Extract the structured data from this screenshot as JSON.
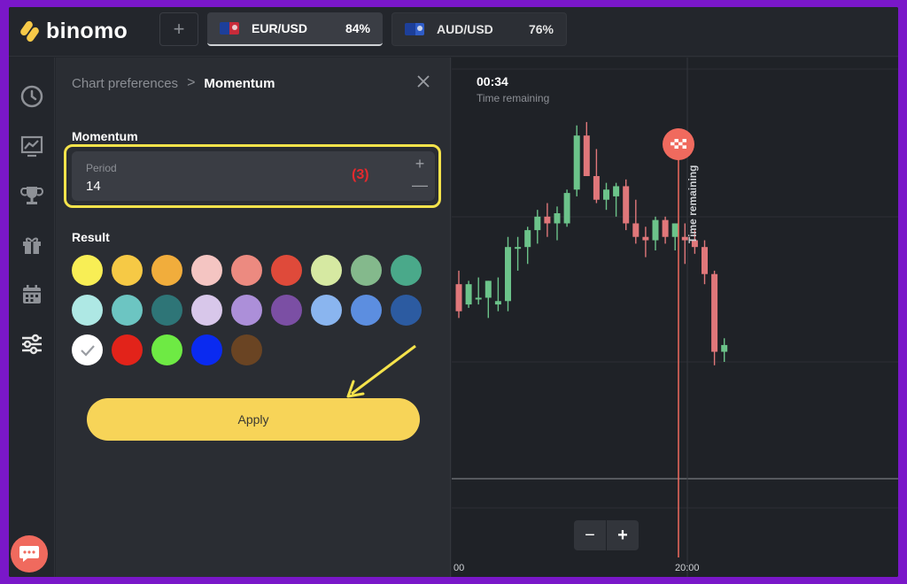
{
  "app": {
    "name": "binomo"
  },
  "header": {
    "add_tab_label": "+",
    "tabs": [
      {
        "asset": "EUR/USD",
        "payout": "84%",
        "active": true
      },
      {
        "asset": "AUD/USD",
        "payout": "76%",
        "active": false
      }
    ]
  },
  "sidebar": {
    "items": [
      {
        "icon": "clock-icon"
      },
      {
        "icon": "chart-icon"
      },
      {
        "icon": "trophy-icon"
      },
      {
        "icon": "gift-icon"
      },
      {
        "icon": "calendar-icon"
      },
      {
        "icon": "sliders-icon",
        "active": true
      }
    ],
    "chat_icon": "chat-icon"
  },
  "panel": {
    "breadcrumb_parent": "Chart preferences",
    "breadcrumb_separator": ">",
    "breadcrumb_current": "Momentum",
    "section_title": "Momentum",
    "period": {
      "label": "Period",
      "value": "14",
      "annotation": "(3)"
    },
    "result_title": "Result",
    "colors": [
      [
        "#f8ee55",
        "#f6c945",
        "#f1ad3c",
        "#f4c5c2",
        "#ec8a80",
        "#df4a3a",
        "#d6e9a2",
        "#84b98c",
        "#4aa98a"
      ],
      [
        "#aee8e4",
        "#6cc5c2",
        "#2e7577",
        "#d8c7ea",
        "#ac8fd9",
        "#7b4fa4",
        "#8ab5ef",
        "#5c8ee0",
        "#2c5ba1"
      ],
      [
        "#ffffff",
        "#e2231a",
        "#6eea44",
        "#0a2af0",
        "#6a4423"
      ]
    ],
    "selected_color": "#ffffff",
    "apply_label": "Apply"
  },
  "chart": {
    "timer": "00:34",
    "timer_label": "Time remaining",
    "expiry_label": "Time remaining",
    "zoom_out_label": "−",
    "zoom_in_label": "+",
    "x_ticks": [
      "00",
      "20:00"
    ],
    "colors": {
      "up": "#6cc38a",
      "down": "#e0777a",
      "expiry": "#f06a5e"
    }
  },
  "chart_data": {
    "type": "candlestick",
    "candles": [
      {
        "o": 56,
        "h": 60,
        "l": 46,
        "c": 48
      },
      {
        "o": 50,
        "h": 57,
        "l": 49,
        "c": 56
      },
      {
        "o": 52,
        "h": 58,
        "l": 50,
        "c": 52
      },
      {
        "o": 52,
        "h": 57,
        "l": 46,
        "c": 57
      },
      {
        "o": 50,
        "h": 58,
        "l": 48,
        "c": 51
      },
      {
        "o": 51,
        "h": 70,
        "l": 48,
        "c": 67
      },
      {
        "o": 67,
        "h": 70,
        "l": 60,
        "c": 67
      },
      {
        "o": 67,
        "h": 73,
        "l": 62,
        "c": 72
      },
      {
        "o": 72,
        "h": 78,
        "l": 68,
        "c": 76
      },
      {
        "o": 76,
        "h": 80,
        "l": 70,
        "c": 74
      },
      {
        "o": 74,
        "h": 79,
        "l": 69,
        "c": 77
      },
      {
        "o": 74,
        "h": 84,
        "l": 73,
        "c": 83
      },
      {
        "o": 84,
        "h": 103,
        "l": 82,
        "c": 100
      },
      {
        "o": 100,
        "h": 104,
        "l": 92,
        "c": 88
      },
      {
        "o": 88,
        "h": 96,
        "l": 80,
        "c": 81
      },
      {
        "o": 81,
        "h": 86,
        "l": 78,
        "c": 84
      },
      {
        "o": 82,
        "h": 86,
        "l": 76,
        "c": 85
      },
      {
        "o": 85,
        "h": 87,
        "l": 72,
        "c": 74
      },
      {
        "o": 74,
        "h": 81,
        "l": 68,
        "c": 70
      },
      {
        "o": 70,
        "h": 73,
        "l": 64,
        "c": 69
      },
      {
        "o": 69,
        "h": 76,
        "l": 66,
        "c": 75
      },
      {
        "o": 75,
        "h": 76,
        "l": 68,
        "c": 70
      },
      {
        "o": 70,
        "h": 74,
        "l": 66,
        "c": 74
      },
      {
        "o": 70,
        "h": 74,
        "l": 62,
        "c": 69
      },
      {
        "o": 69,
        "h": 72,
        "l": 65,
        "c": 67
      },
      {
        "o": 67,
        "h": 69,
        "l": 56,
        "c": 59
      },
      {
        "o": 59,
        "h": 60,
        "l": 32,
        "c": 36
      },
      {
        "o": 36,
        "h": 40,
        "l": 33,
        "c": 38
      }
    ],
    "ylim": [
      0,
      110
    ]
  }
}
